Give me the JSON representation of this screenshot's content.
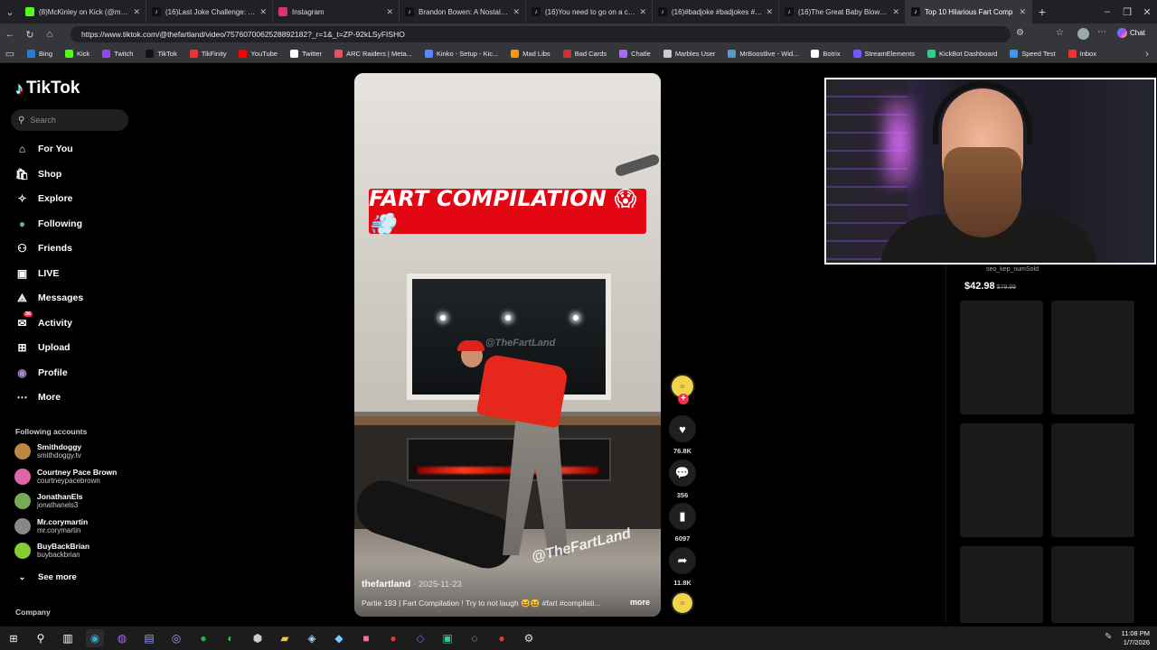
{
  "browser": {
    "tabs": [
      {
        "title": "(8)McKinley on Kick (@mckinle",
        "favicon": "kick"
      },
      {
        "title": "(16)Last Joke Challenge: Couple",
        "favicon": "tiktok"
      },
      {
        "title": "Instagram",
        "favicon": "instagram"
      },
      {
        "title": "Brandon Bowen: A Nostalgic D",
        "favicon": "tiktok"
      },
      {
        "title": "(16)You need to go on a cruise",
        "favicon": "tiktok"
      },
      {
        "title": "(16)#badjoke #badjokes #10m",
        "favicon": "tiktok"
      },
      {
        "title": "(16)The Great Baby Blowout",
        "favicon": "tiktok"
      },
      {
        "title": "Top 10 Hilarious Fart Comp",
        "favicon": "tiktok",
        "active": true
      }
    ],
    "url": "https://www.tiktok.com/@thefartland/video/7576070062528892182?_r=1&_t=ZP-92kLSyFISHO",
    "chat_label": "Chat",
    "bookmarks": [
      "Bing",
      "Kick",
      "Twitch",
      "TikTok",
      "TikFinity",
      "YouTube",
      "Twitter",
      "ARC Raiders | Meta...",
      "Kinko - Setup - Kic...",
      "Mad Libs",
      "Bad Cards",
      "Chatle",
      "Marbles User",
      "MrBoostlive - Wid...",
      "Botrix",
      "StreamElements",
      "KickBot Dashboard",
      "Speed Test",
      "Inbox"
    ]
  },
  "sidebar": {
    "logo": "TikTok",
    "search_placeholder": "Search",
    "nav": [
      {
        "label": "For You",
        "icon": "home-icon"
      },
      {
        "label": "Shop",
        "icon": "shop-icon"
      },
      {
        "label": "Explore",
        "icon": "compass-icon"
      },
      {
        "label": "Following",
        "icon": "following-avatar-icon"
      },
      {
        "label": "Friends",
        "icon": "friends-icon"
      },
      {
        "label": "LIVE",
        "icon": "live-icon"
      },
      {
        "label": "Messages",
        "icon": "messages-icon"
      },
      {
        "label": "Activity",
        "icon": "activity-icon",
        "badge": "36"
      },
      {
        "label": "Upload",
        "icon": "upload-icon"
      },
      {
        "label": "Profile",
        "icon": "profile-icon"
      },
      {
        "label": "More",
        "icon": "more-icon"
      }
    ],
    "following_title": "Following accounts",
    "accounts": [
      {
        "name": "Smithdoggy",
        "handle": "smithdoggy.tv"
      },
      {
        "name": "Courtney Pace Brown",
        "handle": "courtneypacebrown"
      },
      {
        "name": "JonathanEls",
        "handle": "jonathanels3"
      },
      {
        "name": "Mr.corymartin",
        "handle": "mr.corymartin"
      },
      {
        "name": "BuyBackBrian",
        "handle": "buybackbrian"
      }
    ],
    "see_more": "See more",
    "company": "Company"
  },
  "video": {
    "banner": "FART COMPILATION 😱💨",
    "watermark": "@TheFartLand",
    "author": "thefartland",
    "date": "· 2025-11-23",
    "caption": "Partie 193 | Fart Compilation ! Try to not laugh 😆😆 #fart #compilati...",
    "more": "more"
  },
  "actions": {
    "likes": "76.8K",
    "comments": "356",
    "saves": "6097",
    "shares": "11.8K"
  },
  "product": {
    "sold": "seo_kep_numSold",
    "price": "$42.98",
    "old_price": "$79.99"
  },
  "taskbar": {
    "time": "11:08 PM",
    "date": "1/7/2026"
  },
  "colors": {
    "accent": "#fe2c55",
    "banner_red": "#e30613",
    "background": "#000000"
  }
}
